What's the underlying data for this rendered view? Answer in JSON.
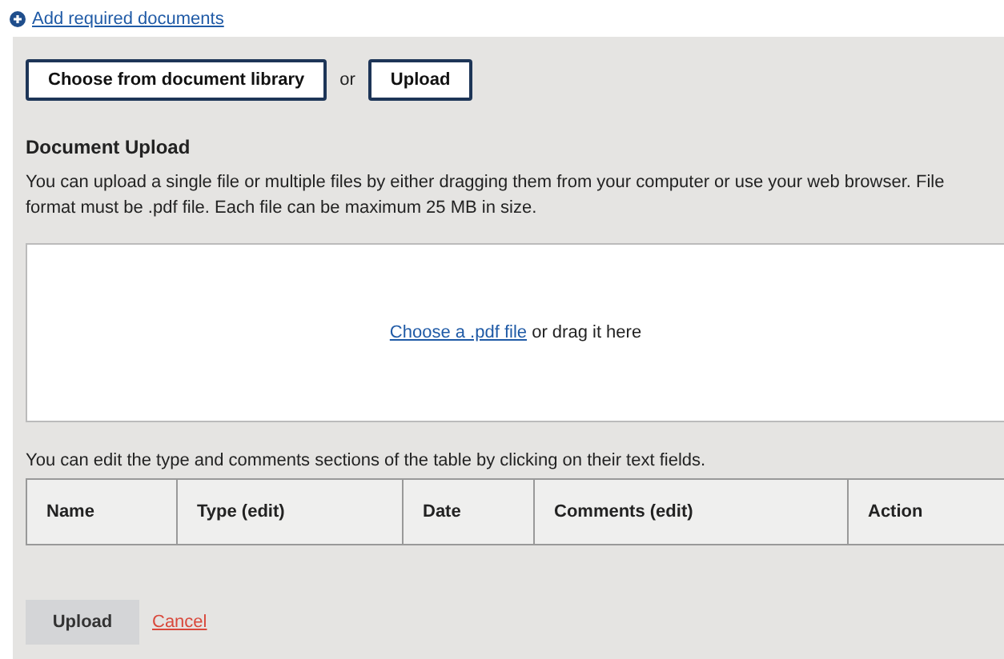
{
  "add_link": {
    "label": "Add required documents"
  },
  "source_buttons": {
    "library": "Choose from document library",
    "separator": "or",
    "upload": "Upload"
  },
  "section": {
    "title": "Document Upload",
    "description": "You can upload a single file or multiple files by either dragging them from your computer or use your web browser. File format must be .pdf file. Each file can be maximum 25 MB in size."
  },
  "drop_zone": {
    "link": "Choose a .pdf file",
    "text": "or drag it here"
  },
  "table_hint": "You can edit the type and comments sections of the table by clicking on their text fields.",
  "table": {
    "columns": [
      "Name",
      "Type (edit)",
      "Date",
      "Comments (edit)",
      "Action"
    ]
  },
  "actions": {
    "upload": "Upload",
    "cancel": "Cancel"
  }
}
